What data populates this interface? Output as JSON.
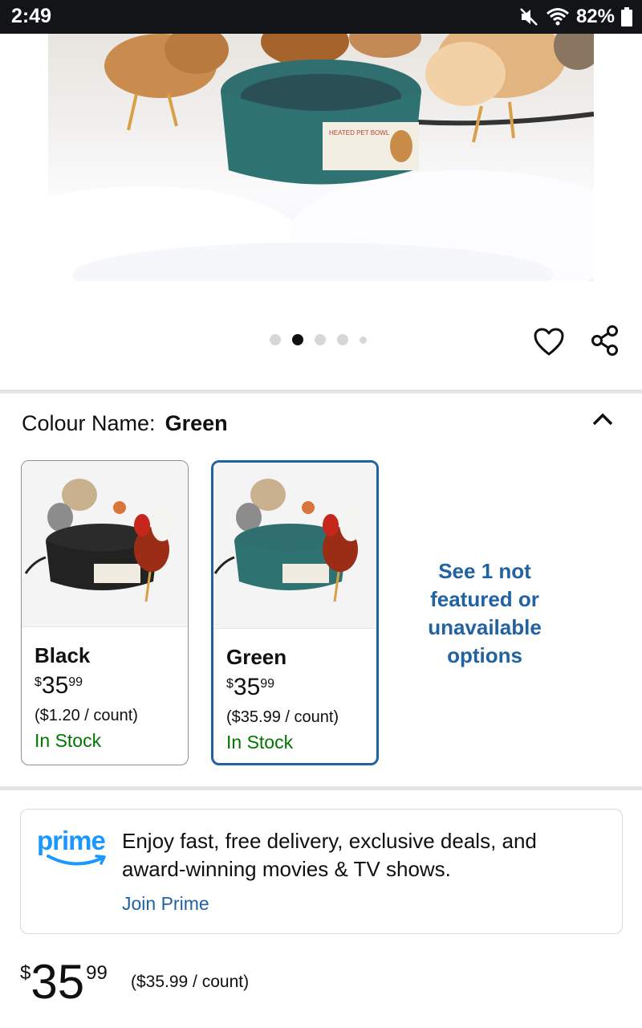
{
  "status_bar": {
    "time": "2:49",
    "battery": "82%",
    "icons": [
      "mute-icon",
      "wifi-icon",
      "battery-icon"
    ]
  },
  "product_image": {
    "label_text": "HEATED PET BOWL"
  },
  "carousel": {
    "total": 5,
    "active_index": 1
  },
  "colour": {
    "label": "Colour Name:",
    "selected": "Green"
  },
  "variants": [
    {
      "name": "Black",
      "price_symbol": "$",
      "price_whole": "35",
      "price_fraction": "99",
      "unit_price": "($1.20 / count)",
      "stock": "In Stock",
      "bowl_color": "#2b2b2b",
      "selected": false
    },
    {
      "name": "Green",
      "price_symbol": "$",
      "price_whole": "35",
      "price_fraction": "99",
      "unit_price": "($35.99 / count)",
      "stock": "In Stock",
      "bowl_color": "#2f6f6f",
      "selected": true
    }
  ],
  "see_more": "See 1 not featured or unavailable options",
  "prime": {
    "logo": "prime",
    "text": "Enjoy fast, free delivery, exclusive deals, and award-winning movies & TV shows.",
    "link": "Join Prime"
  },
  "price": {
    "symbol": "$",
    "whole": "35",
    "fraction": "99",
    "unit": "($35.99 / count)"
  },
  "colors": {
    "link": "#2162a1",
    "stock": "#007600",
    "prime": "#1a98ff"
  }
}
